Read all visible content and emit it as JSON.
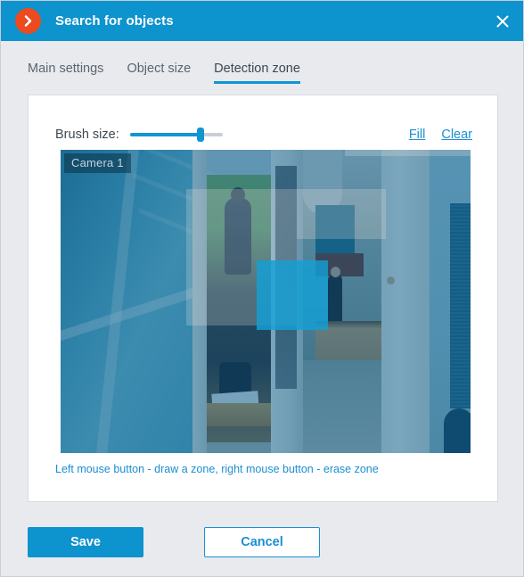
{
  "window": {
    "title": "Search for objects",
    "logo_icon": "chevron-right-circle-icon",
    "close_icon": "close-icon",
    "accent_color": "#0d93ce",
    "logo_color": "#ec4a1f"
  },
  "tabs": [
    {
      "label": "Main settings",
      "active": false
    },
    {
      "label": "Object size",
      "active": false
    },
    {
      "label": "Detection zone",
      "active": true
    }
  ],
  "detection_zone": {
    "brush_label": "Brush size:",
    "brush_value_percent": 76,
    "fill_link": "Fill",
    "clear_link": "Clear",
    "camera_label": "Camera 1",
    "hint": "Left mouse button - draw a zone, right mouse button - erase zone",
    "zone_color": "#14a0d6",
    "mask_color": "#0e5c8c"
  },
  "footer": {
    "save_label": "Save",
    "cancel_label": "Cancel"
  }
}
